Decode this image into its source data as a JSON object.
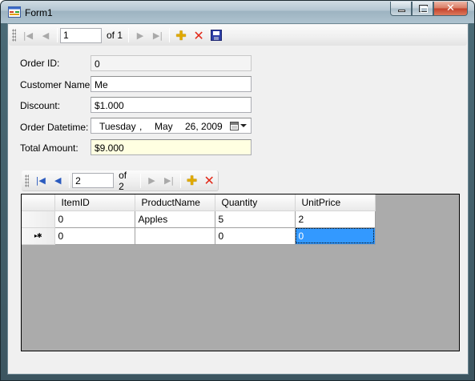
{
  "window": {
    "title": "Form1",
    "minimize_glyph": "",
    "close_glyph": "✕"
  },
  "order_navigator": {
    "first_glyph": "|◀",
    "prev_glyph": "◀",
    "position": "1",
    "count_label": "of 1",
    "next_glyph": "▶",
    "last_glyph": "▶|",
    "add_glyph": "✚",
    "delete_glyph": "✕"
  },
  "form": {
    "order_id": {
      "label": "Order ID:",
      "value": "0"
    },
    "customer_name": {
      "label": "Customer Name:",
      "value": "Me"
    },
    "discount": {
      "label": "Discount:",
      "value": "$1.000"
    },
    "order_datetime": {
      "label": "Order Datetime:",
      "weekday": "Tuesday",
      "sep1": ",",
      "month": "May",
      "day_year": "26, 2009"
    },
    "total_amount": {
      "label": "Total Amount:",
      "value": "$9.000"
    }
  },
  "items_navigator": {
    "first_glyph": "|◀",
    "prev_glyph": "◀",
    "position": "2",
    "count_label": "of 2",
    "next_glyph": "▶",
    "last_glyph": "▶|",
    "add_glyph": "✚",
    "delete_glyph": "✕"
  },
  "grid": {
    "columns": [
      "ItemID",
      "ProductName",
      "Quantity",
      "UnitPrice"
    ],
    "rows": [
      {
        "header": "",
        "cells": [
          "0",
          "Apples",
          "5",
          "2"
        ]
      },
      {
        "header": "▸✱",
        "cells": [
          "0",
          "",
          "0",
          "0"
        ]
      }
    ]
  },
  "colors": {
    "selection": "#3399ff",
    "grid_background": "#ababab",
    "total_field_background": "#ffffe1"
  }
}
